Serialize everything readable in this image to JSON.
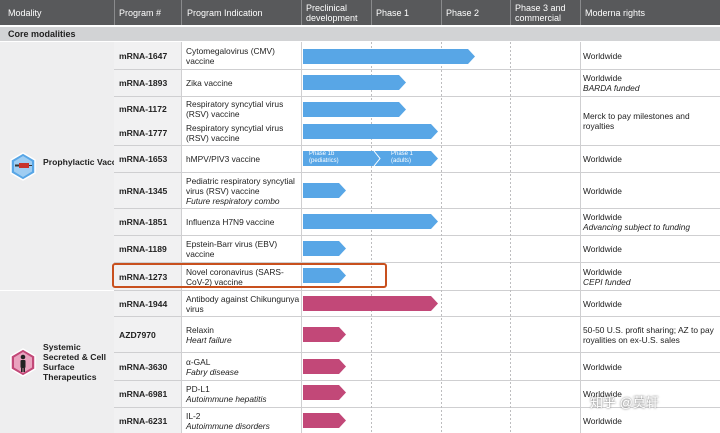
{
  "colors": {
    "header": "#58595b",
    "vaccine": "#58a6e6",
    "therapeutic": "#c24878",
    "highlight": "#c8501e"
  },
  "header": {
    "modality": "Modality",
    "program": "Program #",
    "indication": "Program Indication",
    "preclinical": "Preclinical development",
    "phase1": "Phase 1",
    "phase2": "Phase 2",
    "phase3": "Phase 3 and commercial",
    "rights": "Moderna rights"
  },
  "section": "Core modalities",
  "modalities": [
    {
      "label": "Prophylactic Vaccines",
      "icon": "syringe-icon"
    },
    {
      "label": "Systemic Secreted & Cell Surface Therapeutics",
      "icon": "person-icon"
    }
  ],
  "vaccines": [
    {
      "id": "mRNA-1647",
      "ind": "Cytomegalovirus (CMV) vaccine",
      "sub": "",
      "rights": "Worldwide",
      "rsub": "",
      "progress": "Phase 2"
    },
    {
      "id": "mRNA-1893",
      "ind": "Zika vaccine",
      "sub": "",
      "rights": "Worldwide",
      "rsub": "BARDA funded",
      "progress": "Phase 1"
    },
    {
      "id": "mRNA-1172",
      "ind": "Respiratory syncytial virus (RSV) vaccine",
      "sub": "",
      "rights": "Merck to pay milestones and royalties",
      "rsub": "",
      "progress": "Phase 1"
    },
    {
      "id": "mRNA-1777",
      "ind": "Respiratory syncytial virus (RSV) vaccine",
      "sub": "",
      "rights": "",
      "rsub": "",
      "progress": "Phase 1"
    },
    {
      "id": "mRNA-1653",
      "ind": "hMPV/PIV3 vaccine",
      "sub": "",
      "rights": "Worldwide",
      "rsub": "",
      "progress": "Phase 1",
      "stage_a": "Phase 1b",
      "stage_a2": "(pediatrics)",
      "stage_b": "Phase 1",
      "stage_b2": "(adults)"
    },
    {
      "id": "mRNA-1345",
      "ind": "Pediatric respiratory syncytial virus (RSV) vaccine",
      "sub": "Future respiratory combo",
      "rights": "Worldwide",
      "rsub": "",
      "progress": "Preclinical"
    },
    {
      "id": "mRNA-1851",
      "ind": "Influenza H7N9 vaccine",
      "sub": "",
      "rights": "Worldwide",
      "rsub": "Advancing subject to funding",
      "progress": "Phase 1"
    },
    {
      "id": "mRNA-1189",
      "ind": "Epstein-Barr virus (EBV) vaccine",
      "sub": "",
      "rights": "Worldwide",
      "rsub": "",
      "progress": "Preclinical"
    },
    {
      "id": "mRNA-1273",
      "ind": "Novel coronavirus (SARS-CoV-2) vaccine",
      "sub": "",
      "rights": "Worldwide",
      "rsub": "CEPI funded",
      "progress": "Preclinical"
    }
  ],
  "therapeutics": [
    {
      "id": "mRNA-1944",
      "ind": "Antibody against Chikungunya virus",
      "sub": "",
      "rights": "Worldwide",
      "rsub": "",
      "progress": "Phase 1"
    },
    {
      "id": "AZD7970",
      "ind": "Relaxin",
      "sub": "Heart failure",
      "rights": "50-50 U.S. profit sharing; AZ to pay royalities on ex-U.S. sales",
      "rsub": "",
      "progress": "Preclinical"
    },
    {
      "id": "mRNA-3630",
      "ind": "α-GAL",
      "sub": "Fabry disease",
      "rights": "Worldwide",
      "rsub": "",
      "progress": "Preclinical"
    },
    {
      "id": "mRNA-6981",
      "ind": "PD-L1",
      "sub": "Autoimmune hepatitis",
      "rights": "Worldwide",
      "rsub": "",
      "progress": "Preclinical"
    },
    {
      "id": "mRNA-6231",
      "ind": "IL-2",
      "sub": "Autoimmune disorders",
      "rights": "Worldwide",
      "rsub": "",
      "progress": "Preclinical"
    }
  ],
  "watermark": "知乎 @莫轩"
}
